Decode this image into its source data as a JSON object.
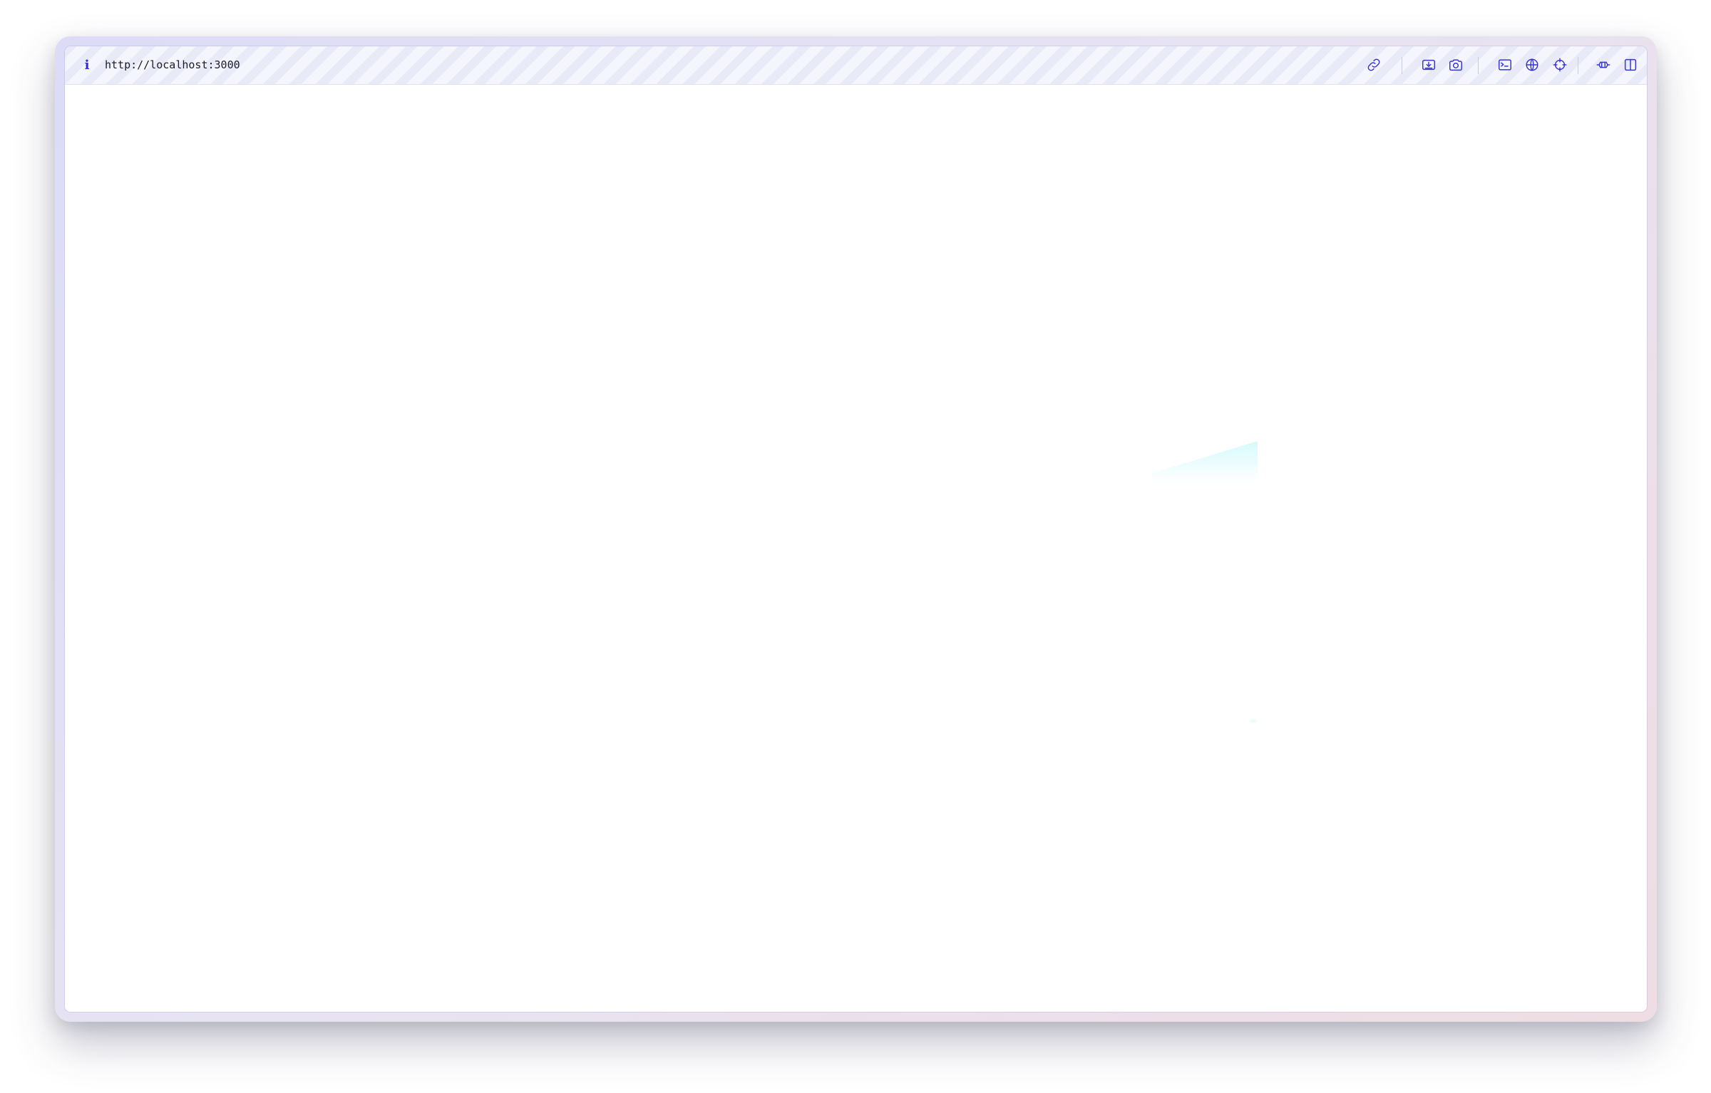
{
  "browser": {
    "url": "http://localhost:3000",
    "info_icon": "i",
    "toolbar_icons": [
      "link-icon",
      "download-icon",
      "camera-icon",
      "terminal-icon",
      "globe-icon",
      "crosshair-icon",
      "bridge-icon",
      "split-view-icon"
    ],
    "accent_color": "#3535d4"
  }
}
